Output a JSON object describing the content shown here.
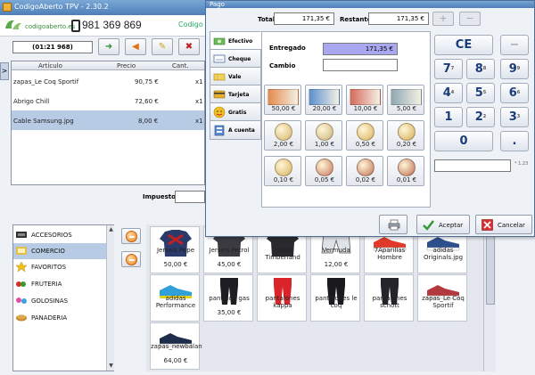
{
  "main": {
    "title": "CodigoAberto TPV - 2.30.2",
    "logo_text": "codigoaberto.es",
    "phone": "981 369 869",
    "logo_small": "Codigo",
    "ticket_id": "(01:21 968)",
    "side_tab": ">"
  },
  "grid": {
    "headers": [
      "Artículo",
      "Precio",
      "Cant."
    ],
    "rows": [
      {
        "item": "zapas_Le Coq Sportif",
        "price": "90,75 €",
        "qty": "x1"
      },
      {
        "item": "Abrigo Chill",
        "price": "72,60 €",
        "qty": "x1"
      },
      {
        "item": "Cable Samsung.jpg",
        "price": "8,00 €",
        "qty": "x1"
      }
    ]
  },
  "taxes_label": "Impuestos",
  "categories": [
    {
      "label": "ACCESORIOS",
      "icon": "accessories-icon"
    },
    {
      "label": "COMERCIO",
      "icon": "commerce-icon"
    },
    {
      "label": "FAVORITOS",
      "icon": "star-icon"
    },
    {
      "label": "FRUTERIA",
      "icon": "fruit-icon"
    },
    {
      "label": "GOLOSINAS",
      "icon": "candy-icon"
    },
    {
      "label": "PANADERIA",
      "icon": "bread-icon"
    }
  ],
  "products": [
    {
      "name": "Jersels Pepe",
      "price": "50,00 €"
    },
    {
      "name": "Jersels Petrol",
      "price": "45,00 €"
    },
    {
      "name": "Jersels Timberland",
      "price": ""
    },
    {
      "name": "Vermuda",
      "price": "12,00 €"
    },
    {
      "name": "7Aparillas Hombre",
      "price": ""
    },
    {
      "name": "adidas Originals.jpg",
      "price": ""
    },
    {
      "name": "adidas Performance",
      "price": ""
    },
    {
      "name": "pantalon gas",
      "price": "35,00 €"
    },
    {
      "name": "pantalones kappa",
      "price": ""
    },
    {
      "name": "pantalones le coq",
      "price": ""
    },
    {
      "name": "pantalones schott",
      "price": ""
    },
    {
      "name": "zapas_Le Coq Sportif",
      "price": ""
    },
    {
      "name": "zapas_newbalan",
      "price": "64,00 €"
    }
  ],
  "dialog": {
    "title": "Pago",
    "total_label": "Total",
    "total_value": "171,35 €",
    "remaining_label": "Restante",
    "remaining_value": "171,35 €",
    "plus": "+",
    "minus": "−",
    "given_label": "Entregado",
    "given_value": "171,35 €",
    "change_label": "Cambio",
    "change_value": "",
    "tabs": [
      {
        "label": "Efectivo",
        "icon": "cash-icon"
      },
      {
        "label": "Cheque",
        "icon": "cheque-icon"
      },
      {
        "label": "Vale",
        "icon": "voucher-icon"
      },
      {
        "label": "Tarjeta",
        "icon": "card-icon"
      },
      {
        "label": "Gratis",
        "icon": "free-icon"
      },
      {
        "label": "A cuenta",
        "icon": "account-icon"
      }
    ],
    "money": [
      {
        "label": "50,00 €",
        "kind": "bill",
        "color": "#e58a4c"
      },
      {
        "label": "20,00 €",
        "kind": "bill",
        "color": "#5b8fd1"
      },
      {
        "label": "10,00 €",
        "kind": "bill",
        "color": "#d66a5a"
      },
      {
        "label": "5,00 €",
        "kind": "bill",
        "color": "#8fa8b4"
      },
      {
        "label": "2,00 €",
        "kind": "coin",
        "color": "#d7b46a"
      },
      {
        "label": "1,00 €",
        "kind": "coin",
        "color": "#c9b27a"
      },
      {
        "label": "0,50 €",
        "kind": "coin",
        "color": "#d9b25a"
      },
      {
        "label": "0,20 €",
        "kind": "coin",
        "color": "#d6ae55"
      },
      {
        "label": "0,10 €",
        "kind": "coin",
        "color": "#d8b35c"
      },
      {
        "label": "0,05 €",
        "kind": "coin",
        "color": "#c8775a"
      },
      {
        "label": "0,02 €",
        "kind": "coin",
        "color": "#c27055"
      },
      {
        "label": "0,01 €",
        "kind": "coin",
        "color": "#c06c52"
      }
    ],
    "keys": [
      {
        "label": "CE",
        "sup": ""
      },
      {
        "label": "−",
        "sup": ""
      },
      {
        "label": "7",
        "sup": "7"
      },
      {
        "label": "8",
        "sup": "8"
      },
      {
        "label": "9",
        "sup": "9"
      },
      {
        "label": "4",
        "sup": "4"
      },
      {
        "label": "5",
        "sup": "5"
      },
      {
        "label": "6",
        "sup": "6"
      },
      {
        "label": "1",
        "sup": ""
      },
      {
        "label": "2",
        "sup": "2"
      },
      {
        "label": "3",
        "sup": "3"
      },
      {
        "label": "0",
        "sup": ""
      },
      {
        "label": ".",
        "sup": ""
      }
    ],
    "display_unit": "* 1.23",
    "accept_label": "Aceptar",
    "cancel_label": "Cancelar"
  },
  "colors": {
    "accent": "#4e7fb8",
    "selection": "#b8cbe5",
    "given_bg": "#a9a7f0"
  }
}
